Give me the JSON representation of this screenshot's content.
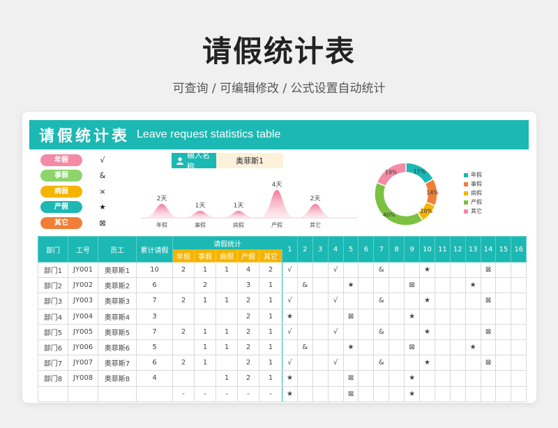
{
  "header": {
    "title": "请假统计表",
    "subtitle": "可查询 /  可编辑修改  /  公式设置自动统计"
  },
  "banner": {
    "title_cn": "请假统计表",
    "title_en": "Leave request statistics table"
  },
  "legend": [
    {
      "label": "年假",
      "symbol": "√",
      "color": "#f48aa6"
    },
    {
      "label": "事假",
      "symbol": "&",
      "color": "#8dd46a"
    },
    {
      "label": "病假",
      "symbol": "×",
      "color": "#f5b400"
    },
    {
      "label": "产假",
      "symbol": "★",
      "color": "#1cb8b3"
    },
    {
      "label": "其它",
      "symbol": "⊠",
      "color": "#ef7e37"
    }
  ],
  "name_search": {
    "label": "输入名称",
    "value": "奥菲斯1"
  },
  "peak_chart": {
    "items": [
      {
        "label": "年假",
        "value": "2天",
        "days": 2
      },
      {
        "label": "事假",
        "value": "1天",
        "days": 1
      },
      {
        "label": "病假",
        "value": "1天",
        "days": 1
      },
      {
        "label": "产假",
        "value": "4天",
        "days": 4
      },
      {
        "label": "其它",
        "value": "2天",
        "days": 2
      }
    ]
  },
  "chart_data": {
    "type": "pie",
    "categories": [
      "年假",
      "事假",
      "病假",
      "产假",
      "其它"
    ],
    "values": [
      17,
      14,
      10,
      40,
      19
    ],
    "labels": [
      "17%",
      "14%",
      "10%",
      "40%",
      "19%"
    ],
    "colors": [
      "#1cb8b3",
      "#ef7e37",
      "#f5b400",
      "#7cc242",
      "#f48aa6"
    ]
  },
  "table": {
    "headers": [
      "部门",
      "工号",
      "员工",
      "累计请假"
    ],
    "group_header": "请假统计",
    "leave_types": [
      "年假",
      "事假",
      "病假",
      "产假",
      "其它"
    ],
    "days": [
      "1",
      "2",
      "3",
      "4",
      "5",
      "6",
      "7",
      "8",
      "9",
      "10",
      "11",
      "12",
      "13",
      "14",
      "15",
      "16"
    ],
    "rows": [
      {
        "dept": "部门1",
        "id": "JY001",
        "name": "奥菲斯1",
        "total": "10",
        "counts": [
          "2",
          "1",
          "1",
          "4",
          "2"
        ],
        "marks": [
          "√",
          "",
          "",
          "√",
          "",
          "",
          "&",
          "",
          "",
          "★",
          "",
          "",
          "",
          "⊠",
          "",
          ""
        ]
      },
      {
        "dept": "部门2",
        "id": "JY002",
        "name": "奥菲斯2",
        "total": "6",
        "counts": [
          "",
          "2",
          "",
          "3",
          "1"
        ],
        "marks": [
          "",
          "&",
          "",
          "",
          "★",
          "",
          "",
          "",
          "⊠",
          "",
          "",
          "",
          "★",
          "",
          "",
          ""
        ]
      },
      {
        "dept": "部门3",
        "id": "JY003",
        "name": "奥菲斯3",
        "total": "7",
        "counts": [
          "2",
          "1",
          "1",
          "2",
          "1"
        ],
        "marks": [
          "√",
          "",
          "",
          "√",
          "",
          "",
          "&",
          "",
          "",
          "★",
          "",
          "",
          "",
          "⊠",
          "",
          ""
        ]
      },
      {
        "dept": "部门4",
        "id": "JY004",
        "name": "奥菲斯4",
        "total": "3",
        "counts": [
          "",
          "",
          "",
          "2",
          "1"
        ],
        "marks": [
          "★",
          "",
          "",
          "",
          "⊠",
          "",
          "",
          "",
          "★",
          "",
          "",
          "",
          "",
          "",
          "",
          ""
        ]
      },
      {
        "dept": "部门5",
        "id": "JY005",
        "name": "奥菲斯5",
        "total": "7",
        "counts": [
          "2",
          "1",
          "1",
          "2",
          "1"
        ],
        "marks": [
          "√",
          "",
          "",
          "√",
          "",
          "",
          "&",
          "",
          "",
          "★",
          "",
          "",
          "",
          "⊠",
          "",
          ""
        ]
      },
      {
        "dept": "部门6",
        "id": "JY006",
        "name": "奥菲斯6",
        "total": "5",
        "counts": [
          "",
          "1",
          "1",
          "2",
          "1"
        ],
        "marks": [
          "",
          "&",
          "",
          "",
          "★",
          "",
          "",
          "",
          "⊠",
          "",
          "",
          "",
          "★",
          "",
          "",
          ""
        ]
      },
      {
        "dept": "部门7",
        "id": "JY007",
        "name": "奥菲斯7",
        "total": "6",
        "counts": [
          "2",
          "1",
          "",
          "2",
          "1"
        ],
        "marks": [
          "√",
          "",
          "",
          "√",
          "",
          "",
          "&",
          "",
          "",
          "★",
          "",
          "",
          "",
          "⊠",
          "",
          ""
        ]
      },
      {
        "dept": "部门8",
        "id": "JY008",
        "name": "奥菲斯8",
        "total": "4",
        "counts": [
          "",
          "",
          "1",
          "2",
          "1"
        ],
        "marks": [
          "★",
          "",
          "",
          "",
          "⊠",
          "",
          "",
          "",
          "★",
          "",
          "",
          "",
          "",
          "",
          "",
          ""
        ]
      },
      {
        "dept": "",
        "id": "",
        "name": "",
        "total": "",
        "counts": [
          "-",
          "-",
          "-",
          "-",
          "-"
        ],
        "marks": [
          "★",
          "",
          "",
          "",
          "⊠",
          "",
          "",
          "",
          "★",
          "",
          "",
          "",
          "",
          "",
          "",
          ""
        ]
      }
    ]
  }
}
